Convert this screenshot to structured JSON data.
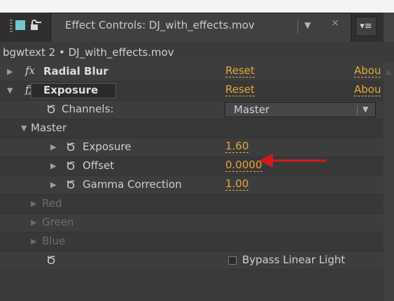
{
  "panel": {
    "tab_title": "Effect Controls: DJ_with_effects.mov",
    "tab_dropdown_glyph": "▼",
    "tab_close_glyph": "×",
    "panel_menu_glyph": "▾≡",
    "lock_icon": "lock-icon",
    "label_color": "#74c6c9"
  },
  "breadcrumb": "bgwtext 2 • DJ_with_effects.mov",
  "effects": [
    {
      "name": "Radial Blur",
      "fx": "fx",
      "reset": "Reset",
      "about": "Abou",
      "expanded": false
    },
    {
      "name": "Exposure",
      "fx": "fx",
      "reset": "Reset",
      "about": "Abou",
      "expanded": true,
      "channels_label": "Channels:",
      "channels_value": "Master",
      "group_label": "Master",
      "properties": [
        {
          "label": "Exposure",
          "value": "1.60"
        },
        {
          "label": "Offset",
          "value": "0.0000"
        },
        {
          "label": "Gamma Correction",
          "value": "1.00"
        }
      ],
      "disabled_groups": [
        "Red",
        "Green",
        "Blue"
      ],
      "bypass_label": "Bypass Linear Light",
      "bypass_checked": false
    }
  ],
  "annotation": {
    "color": "#d11a1a",
    "points_to": "Exposure value"
  },
  "colors": {
    "accent_value": "#e6a63a",
    "panel_bg": "#3a3a3a"
  }
}
